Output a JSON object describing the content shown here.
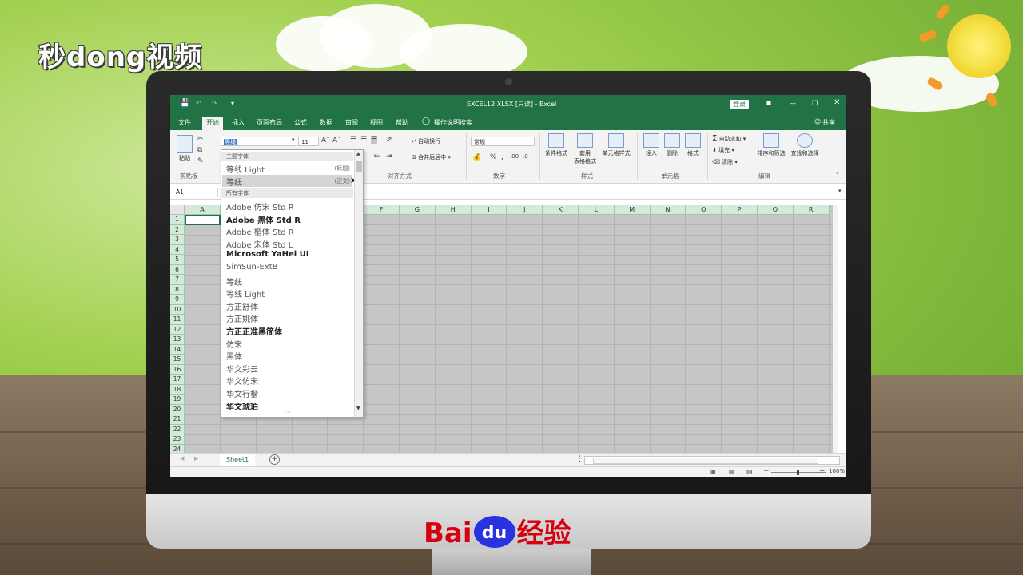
{
  "watermarks": {
    "top_logo": "秒dong视频",
    "baidu_prefix": "Bai",
    "baidu_paw": "du",
    "baidu_suffix": "经验"
  },
  "title_bar": {
    "title": "EXCEL12.XLSX [只读] - Excel",
    "login": "登录"
  },
  "menu_tabs": [
    {
      "label": "文件"
    },
    {
      "label": "开始",
      "active": true
    },
    {
      "label": "插入"
    },
    {
      "label": "页面布局"
    },
    {
      "label": "公式"
    },
    {
      "label": "数据"
    },
    {
      "label": "审阅"
    },
    {
      "label": "视图"
    },
    {
      "label": "帮助"
    },
    {
      "label": "操作说明搜索"
    }
  ],
  "share": "共享",
  "ribbon": {
    "clipboard": {
      "paste": "粘贴",
      "group": "剪贴板"
    },
    "font": {
      "name_value": "等线",
      "size_value": "11"
    },
    "alignment": {
      "wrap": "自动换行",
      "merge": "合并后居中",
      "group": "对齐方式"
    },
    "number": {
      "format": "常规",
      "percent": "%",
      "group": "数字"
    },
    "styles": {
      "conditional": "条件格式",
      "table_line1": "套用",
      "table_line2": "表格格式",
      "cell_styles": "单元格样式",
      "group": "样式"
    },
    "cells": {
      "insert": "插入",
      "delete": "删除",
      "format": "格式",
      "group": "单元格"
    },
    "editing": {
      "autosum": "自动求和",
      "fill": "填充",
      "clear": "清除",
      "sort": "排序和筛选",
      "find": "查找和选择",
      "group": "编辑"
    }
  },
  "name_box": "A1",
  "columns": [
    "A",
    "B",
    "C",
    "D",
    "E",
    "F",
    "G",
    "H",
    "I",
    "J",
    "K",
    "L",
    "M",
    "N",
    "O",
    "P",
    "Q",
    "R"
  ],
  "rows": [
    "1",
    "2",
    "3",
    "4",
    "5",
    "6",
    "7",
    "8",
    "9",
    "10",
    "11",
    "12",
    "13",
    "14",
    "15",
    "16",
    "17",
    "18",
    "19",
    "20",
    "21",
    "22",
    "23",
    "24"
  ],
  "sheet": {
    "tab": "Sheet1",
    "add": "+"
  },
  "status": {
    "zoom": "100%"
  },
  "font_dropdown": {
    "theme_section": "主题字体",
    "theme_fonts": [
      {
        "name": "等线 Light",
        "tag": "(标题)"
      },
      {
        "name": "等线",
        "tag": "(正文)"
      }
    ],
    "all_section": "所有字体",
    "all_fonts": [
      {
        "name": "Adobe 仿宋 Std R"
      },
      {
        "name": "Adobe 黑体 Std R",
        "bold": true
      },
      {
        "name": "Adobe 楷体 Std R"
      },
      {
        "name": "Adobe 宋体 Std L"
      },
      {
        "name": "Microsoft YaHei UI",
        "bold": true
      },
      {
        "name": "SimSun-ExtB"
      },
      {
        "name": "等线"
      },
      {
        "name": "等线 Light"
      },
      {
        "name": "方正舒体"
      },
      {
        "name": "方正姚体"
      },
      {
        "name": "方正正准黑简体",
        "bold": true
      },
      {
        "name": "仿宋"
      },
      {
        "name": "黑体"
      },
      {
        "name": "华文彩云"
      },
      {
        "name": "华文仿宋"
      },
      {
        "name": "华文行楷"
      },
      {
        "name": "华文琥珀",
        "bold": true
      }
    ]
  }
}
